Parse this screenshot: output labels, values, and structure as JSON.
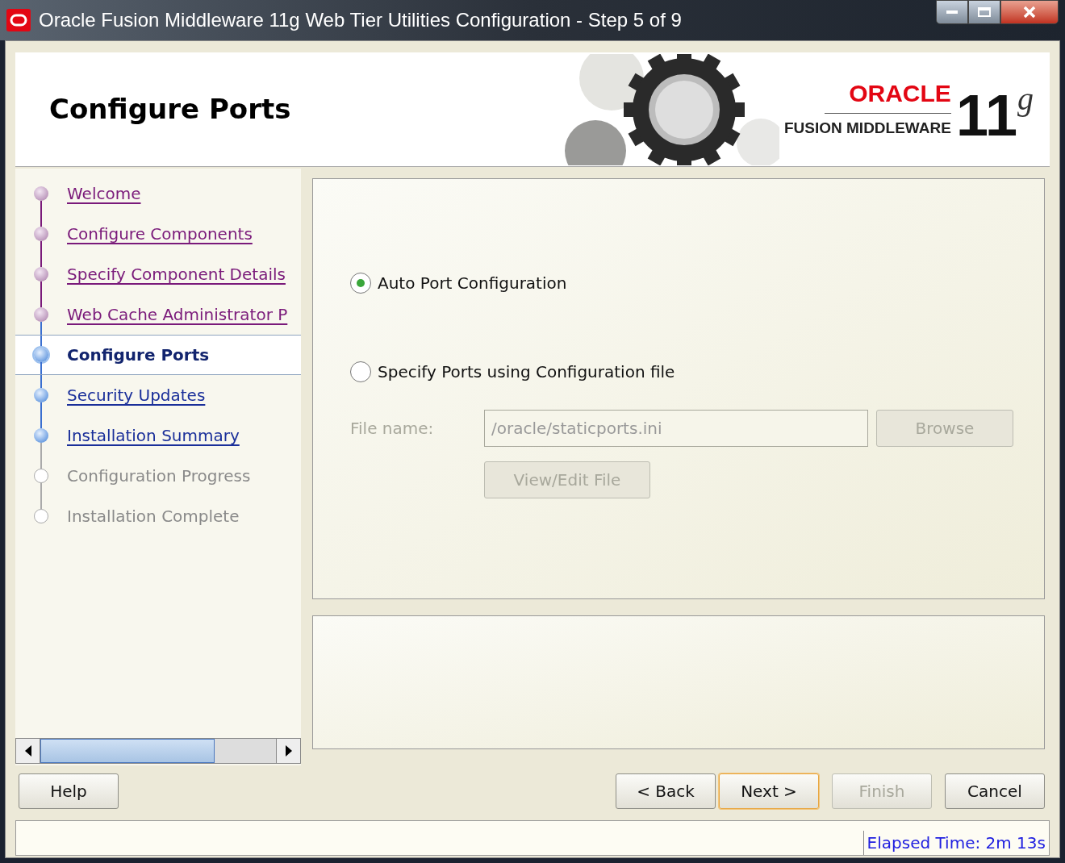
{
  "window": {
    "title": "Oracle Fusion Middleware 11g Web Tier Utilities Configuration - Step 5 of 9"
  },
  "header": {
    "title": "Configure Ports",
    "logo": {
      "brand": "ORACLE",
      "product": "FUSION MIDDLEWARE",
      "version": "11",
      "suffix": "g"
    }
  },
  "steps": [
    {
      "label": "Welcome",
      "kind": "done",
      "selected": false
    },
    {
      "label": "Configure Components",
      "kind": "done",
      "selected": false
    },
    {
      "label": "Specify Component Details",
      "kind": "done",
      "selected": false
    },
    {
      "label": "Web Cache Administrator P",
      "kind": "done",
      "selected": false
    },
    {
      "label": "Configure Ports",
      "kind": "current",
      "selected": true
    },
    {
      "label": "Security Updates",
      "kind": "available",
      "selected": false
    },
    {
      "label": "Installation Summary",
      "kind": "available",
      "selected": false
    },
    {
      "label": "Configuration Progress",
      "kind": "pending",
      "selected": false
    },
    {
      "label": "Installation Complete",
      "kind": "pending",
      "selected": false
    }
  ],
  "options": [
    {
      "label": "Auto Port Configuration",
      "selected": true
    },
    {
      "label": "Specify Ports using Configuration file",
      "selected": false
    }
  ],
  "file": {
    "label": "File name:",
    "value": "/oracle/staticports.ini",
    "disabled": true,
    "browse": "Browse",
    "view_edit": "View/Edit File"
  },
  "buttons": [
    {
      "label": "Help",
      "disabled": false,
      "focused": false
    },
    {
      "label": "< Back",
      "disabled": false,
      "focused": false
    },
    {
      "label": "Next >",
      "disabled": false,
      "focused": true
    },
    {
      "label": "Finish",
      "disabled": true,
      "focused": false
    },
    {
      "label": "Cancel",
      "disabled": false,
      "focused": false
    }
  ],
  "status_bar": {
    "elapsed": "Elapsed Time: 2m 13s"
  }
}
